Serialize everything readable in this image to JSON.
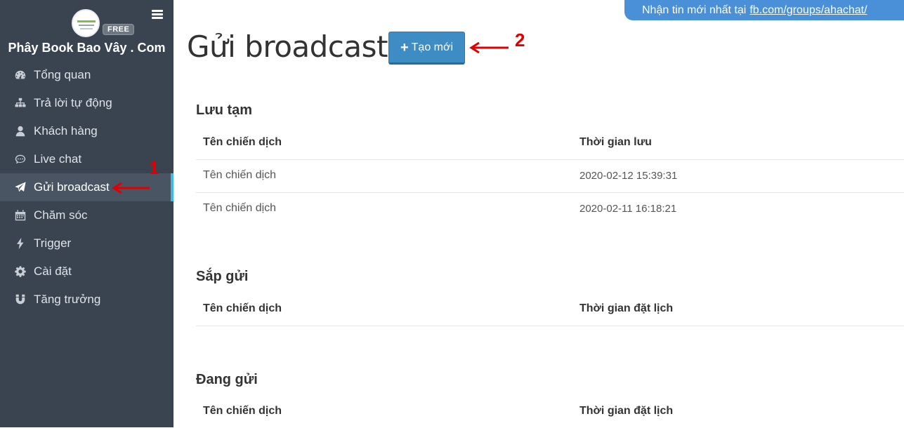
{
  "sidebar": {
    "brand": "Phây Book Bao Vây . Com",
    "badge": "FREE",
    "items": [
      {
        "label": "Tổng quan",
        "icon": "dashboard-icon"
      },
      {
        "label": "Trả lời tự động",
        "icon": "sitemap-icon"
      },
      {
        "label": "Khách hàng",
        "icon": "user-icon"
      },
      {
        "label": "Live chat",
        "icon": "chat-bubble-icon"
      },
      {
        "label": "Gửi broadcast",
        "icon": "paper-plane-icon",
        "active": true
      },
      {
        "label": "Chăm sóc",
        "icon": "calendar-icon"
      },
      {
        "label": "Trigger",
        "icon": "bolt-icon"
      },
      {
        "label": "Cài đặt",
        "icon": "gear-icon"
      },
      {
        "label": "Tăng trưởng",
        "icon": "magnet-icon"
      }
    ]
  },
  "notice": {
    "text": "Nhận tin mới nhất tại",
    "link": "fb.com/groups/ahachat/"
  },
  "page": {
    "title": "Gửi broadcast",
    "new_button": "Tạo mới"
  },
  "annotations": {
    "one": "1",
    "two": "2"
  },
  "sections": {
    "drafts": {
      "title": "Lưu tạm",
      "columns": [
        "Tên chiến dịch",
        "Thời gian lưu"
      ],
      "rows": [
        [
          "Tên chiến dịch",
          "2020-02-12 15:39:31"
        ],
        [
          "Tên chiến dịch",
          "2020-02-11 16:18:21"
        ]
      ]
    },
    "scheduled": {
      "title": "Sắp gửi",
      "columns": [
        "Tên chiến dịch",
        "Thời gian đặt lịch"
      ]
    },
    "sending": {
      "title": "Đang gửi",
      "columns": [
        "Tên chiến dịch",
        "Thời gian đặt lịch"
      ]
    }
  },
  "colors": {
    "sidebar_bg": "#3a4451",
    "active_bg": "#4a5563",
    "active_indicator": "#3fb8e8",
    "primary_button": "#3d8cc4",
    "notice_bg": "#4a90d9",
    "annotation": "#e10000"
  }
}
